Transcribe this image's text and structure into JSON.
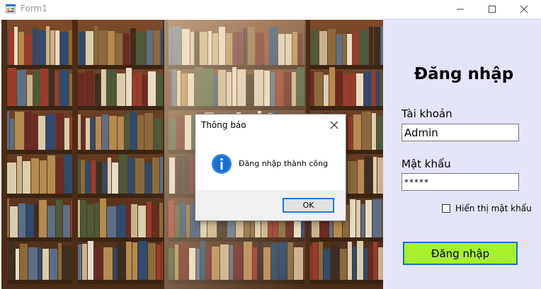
{
  "window": {
    "title": "Form1",
    "minimize_icon": "minimize-icon",
    "maximize_icon": "maximize-icon",
    "close_icon": "close-icon"
  },
  "image": {
    "description_icon": "bookshelf-photo"
  },
  "login": {
    "heading": "Đăng nhập",
    "username_label": "Tài khoản",
    "username_value": "Admin",
    "password_label": "Mật khẩu",
    "password_value": "*****",
    "show_password_label": "Hiển thị mật khẩu",
    "show_password_checked": false,
    "submit_label": "Đăng nhập",
    "colors": {
      "panel": "#e4e4f9",
      "button": "#a6f12a",
      "button_border": "#1474d4"
    }
  },
  "messagebox": {
    "title": "Thông báo",
    "message": "Đăng nhập thành công",
    "icon": "info-icon",
    "ok_label": "OK"
  }
}
